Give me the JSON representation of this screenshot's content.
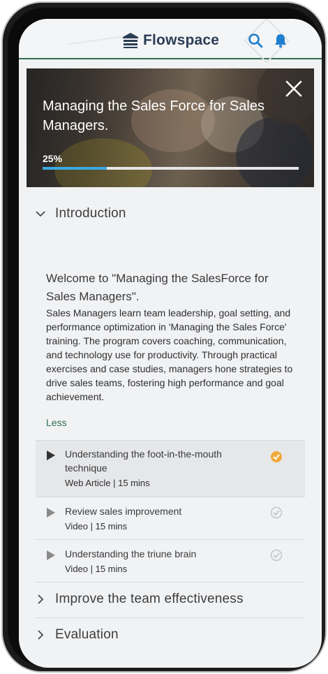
{
  "header": {
    "brand": "Flowspace",
    "icons": {
      "logo": "flowspace-logo-icon",
      "search": "search-icon",
      "notifications": "bell-icon"
    },
    "colors": {
      "brand_text": "#2b3d55",
      "accent": "#1e7fd0",
      "rule": "#2f6f4f"
    }
  },
  "course": {
    "title": "Managing the Sales Force for Sales Managers.",
    "progress_label": "25%",
    "progress": 0.25,
    "close_icon": "close-icon",
    "progress_color": "#39a9e0"
  },
  "sections": [
    {
      "label": "Introduction",
      "expanded": true,
      "intro_title": "Welcome to \"Managing the SalesForce for Sales Managers\".",
      "intro_body": "Sales Managers learn team leadership, goal setting, and performance optimization in 'Managing the Sales Force' training. The program covers coaching, communication, and technology use for productivity. Through practical exercises and case studies, managers hone strategies to drive sales teams, fostering high performance and goal achievement.",
      "less_label": "Less",
      "lessons": [
        {
          "title": "Understanding the foot-in-the-mouth technique",
          "meta": "Web Article | 15 mins",
          "completed": true
        },
        {
          "title": "Review sales improvement",
          "meta": "Video | 15 mins",
          "completed": false
        },
        {
          "title": "Understanding the triune brain",
          "meta": "Video | 15 mins",
          "completed": false
        }
      ]
    },
    {
      "label": "Improve the team effectiveness",
      "expanded": false
    },
    {
      "label": "Evaluation",
      "expanded": false
    }
  ],
  "colors": {
    "completed": "#f0a93a",
    "pending": "#c4c6c8",
    "link": "#2f6f4f"
  }
}
